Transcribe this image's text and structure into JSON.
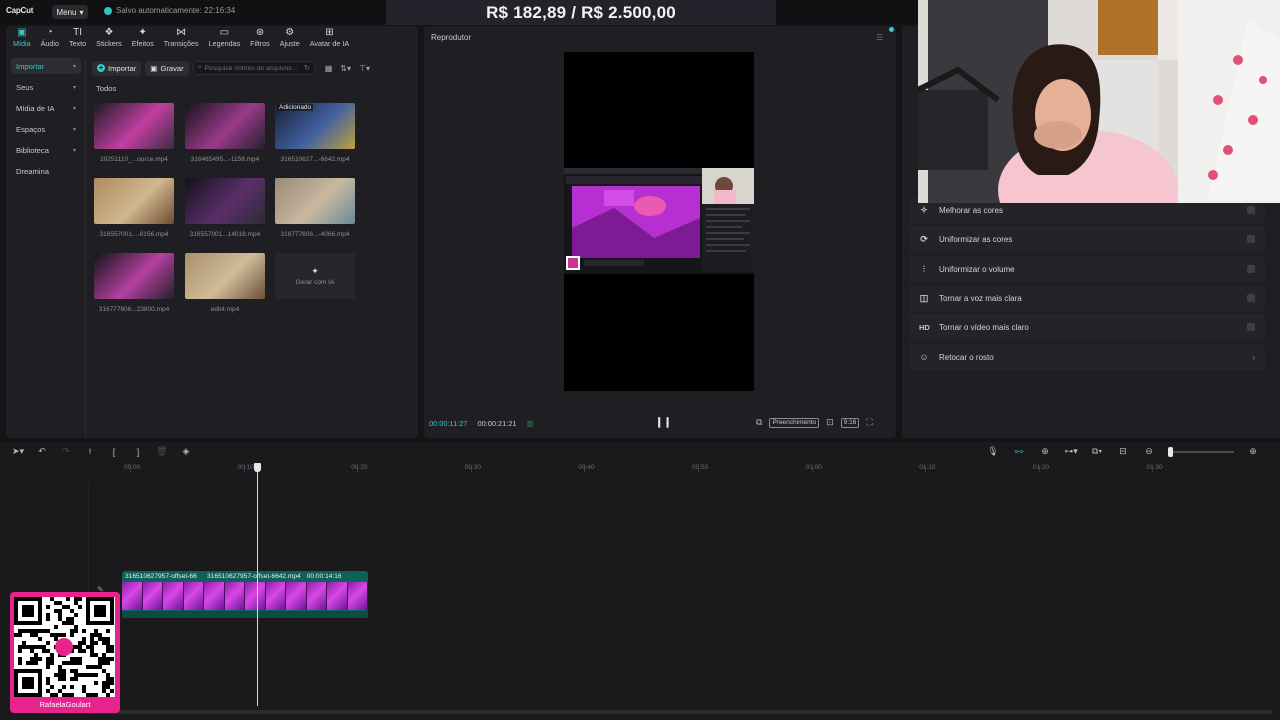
{
  "app": {
    "logo": "CapCut",
    "menu_label": "Menu",
    "autosave": "Salvo automaticamente: 22:16:34"
  },
  "overlay": {
    "donation": "R$ 182,89 / R$ 2.500,00",
    "qr_name": "RafaelaGoulart"
  },
  "tabs": [
    {
      "label": "Mídia",
      "icon": "media-icon",
      "active": true
    },
    {
      "label": "Áudio",
      "icon": "audio-icon"
    },
    {
      "label": "Texto",
      "icon": "text-icon"
    },
    {
      "label": "Stickers",
      "icon": "sticker-icon"
    },
    {
      "label": "Efeitos",
      "icon": "effects-icon"
    },
    {
      "label": "Transições",
      "icon": "transitions-icon"
    },
    {
      "label": "Legendas",
      "icon": "captions-icon"
    },
    {
      "label": "Filtros",
      "icon": "filters-icon"
    },
    {
      "label": "Ajuste",
      "icon": "adjust-icon"
    },
    {
      "label": "Avatar de IA",
      "icon": "ai-avatar-icon"
    }
  ],
  "sidebar": {
    "items": [
      {
        "label": "Importar",
        "active": true,
        "chevron": true
      },
      {
        "label": "Seus",
        "chevron": true
      },
      {
        "label": "Mídia de IA",
        "chevron": true
      },
      {
        "label": "Espaços",
        "chevron": true
      },
      {
        "label": "Biblioteca",
        "chevron": true
      },
      {
        "label": "Dreamina",
        "chevron": false
      }
    ]
  },
  "media_toolbar": {
    "import_label": "Importar",
    "record_label": "Gravar",
    "search_placeholder": "Pesquise nomes de arquivos..."
  },
  "media": {
    "section_title": "Todos",
    "added_badge": "Adicionado",
    "ai_generate_label": "Gerar com IA",
    "files": [
      {
        "name": "20251110_...ource.mp4"
      },
      {
        "name": "316465495...-1158.mp4"
      },
      {
        "name": "316510627...-6642.mp4",
        "added": true
      },
      {
        "name": "316557001...-8156.mp4"
      },
      {
        "name": "316557001...14018.mp4"
      },
      {
        "name": "316777606...-4066.mp4"
      },
      {
        "name": "316777606...23800.mp4"
      },
      {
        "name": "edit4.mp4"
      }
    ]
  },
  "player": {
    "title": "Reprodutor",
    "current_time": "00:00:11:27",
    "total_time": "00:00:21:21",
    "fill_label": "Preenchimento",
    "ratio_label": "9:16"
  },
  "right_panel": {
    "rows": [
      {
        "label": "Melhorar as cores",
        "icon": "color-wand-icon"
      },
      {
        "label": "Uniformizar as cores",
        "icon": "color-match-icon"
      },
      {
        "label": "Uniformizar o volume",
        "icon": "volume-level-icon"
      },
      {
        "label": "Tornar a voz mais clara",
        "icon": "voice-clarity-icon"
      },
      {
        "label": "Tornar o vídeo mais claro",
        "icon": "hd-icon",
        "glyph": "HD"
      },
      {
        "label": "Retocar o rosto",
        "icon": "face-retouch-icon",
        "chevron": true
      }
    ]
  },
  "timeline": {
    "ticks": [
      "00:00",
      "00:10",
      "00:20",
      "00:30",
      "00:40",
      "00:50",
      "01:00",
      "01:10",
      "01:20",
      "01:30"
    ],
    "clip": {
      "name_a": "316510627957-offset-66",
      "name_b": "316510627957-offset-6642.mp4",
      "duration": "00:00:14:16"
    },
    "zoom_level": 0
  },
  "colors": {
    "accent": "#35c9c9",
    "clip": "#0f5f5a",
    "qr_frame": "#e6248c"
  }
}
